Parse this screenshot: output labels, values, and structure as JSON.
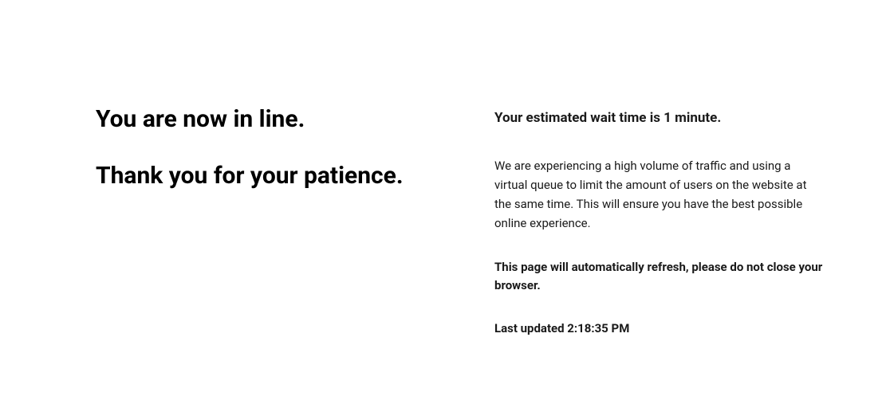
{
  "left": {
    "line1": "You are now in line.",
    "line2": "Thank you for your patience."
  },
  "right": {
    "wait_heading": "Your estimated wait time is 1 minute.",
    "body": "We are experiencing a high volume of traffic and using a virtual queue to limit the amount of users on the website at the same time. This will ensure you have the best possible online experience.",
    "refresh_note": "This page will automatically refresh, please do not close your browser.",
    "last_updated": "Last updated 2:18:35 PM"
  }
}
